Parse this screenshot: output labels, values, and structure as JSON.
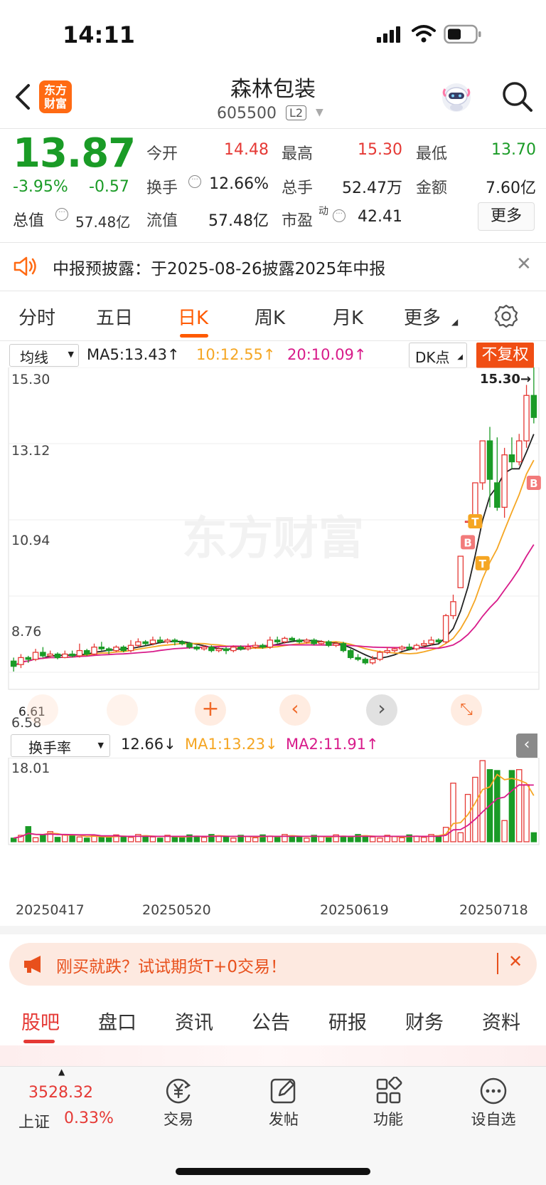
{
  "status": {
    "time": "14:11"
  },
  "header": {
    "logo_line1": "东方",
    "logo_line2": "财富",
    "name": "森林包装",
    "code": "605500",
    "l2": "L2"
  },
  "quote": {
    "price": "13.87",
    "change_pct": "-3.95%",
    "change": "-0.57",
    "total_value_label": "总值",
    "total_value": "57.48亿",
    "open_label": "今开",
    "open": "14.48",
    "high_label": "最高",
    "high": "15.30",
    "low_label": "最低",
    "low": "13.70",
    "turnover_label": "换手",
    "turnover": "12.66%",
    "volume_label": "总手",
    "volume": "52.47万",
    "amount_label": "金额",
    "amount": "7.60亿",
    "float_label": "流值",
    "float_value": "57.48亿",
    "pe_label": "市盈",
    "pe_sup": "动",
    "pe": "42.41",
    "more_label": "更多"
  },
  "notice": {
    "text": "中报预披露：于2025-08-26披露2025年中报"
  },
  "kline_tabs": [
    {
      "label": "分时",
      "active": false
    },
    {
      "label": "五日",
      "active": false
    },
    {
      "label": "日K",
      "active": true
    },
    {
      "label": "周K",
      "active": false
    },
    {
      "label": "月K",
      "active": false
    },
    {
      "label": "更多",
      "active": false
    }
  ],
  "ma_legend": {
    "selector": "均线",
    "ma5": "MA5:13.43↑",
    "ma10": "10:12.55↑",
    "ma20": "20:10.09↑",
    "dk_label": "DK点",
    "fq_label": "不复权",
    "colors": {
      "ma5": "#222222",
      "ma10": "#f5a623",
      "ma20": "#d81b8a"
    }
  },
  "price_axis": {
    "labels": [
      "15.30",
      "13.12",
      "10.94",
      "8.76",
      "6.58"
    ],
    "max_marker": "15.30→",
    "min_marker": "6.61"
  },
  "watermark": "东方财富",
  "turnover_legend": {
    "selector": "换手率",
    "value": "12.66↓",
    "ma1": "MA1:13.23↓",
    "ma2": "MA2:11.91↑",
    "axis_max": "18.01"
  },
  "date_axis": [
    "20250417",
    "20250520",
    "20250619",
    "20250718"
  ],
  "chart_data": {
    "type": "candlestick",
    "ylim": [
      6.58,
      15.3
    ],
    "price_labels": [
      15.3,
      13.12,
      10.94,
      8.76,
      6.58
    ],
    "candles": [
      [
        6.9,
        6.75,
        7.0,
        6.6
      ],
      [
        6.8,
        7.0,
        7.1,
        6.7
      ],
      [
        7.0,
        6.95,
        7.05,
        6.85
      ],
      [
        6.95,
        7.15,
        7.25,
        6.9
      ],
      [
        7.15,
        7.05,
        7.3,
        7.0
      ],
      [
        7.05,
        7.1,
        7.2,
        7.0
      ],
      [
        7.1,
        7.0,
        7.15,
        6.95
      ],
      [
        7.0,
        7.1,
        7.2,
        6.98
      ],
      [
        7.1,
        7.05,
        7.2,
        7.0
      ],
      [
        7.05,
        7.2,
        7.4,
        7.0
      ],
      [
        7.2,
        7.1,
        7.25,
        7.05
      ],
      [
        7.1,
        7.3,
        7.4,
        7.05
      ],
      [
        7.3,
        7.25,
        7.45,
        7.2
      ],
      [
        7.25,
        7.2,
        7.3,
        7.1
      ],
      [
        7.2,
        7.3,
        7.35,
        7.15
      ],
      [
        7.3,
        7.2,
        7.35,
        7.15
      ],
      [
        7.2,
        7.35,
        7.5,
        7.15
      ],
      [
        7.35,
        7.45,
        7.55,
        7.3
      ],
      [
        7.45,
        7.4,
        7.5,
        7.35
      ],
      [
        7.4,
        7.5,
        7.6,
        7.35
      ],
      [
        7.5,
        7.45,
        7.6,
        7.4
      ],
      [
        7.45,
        7.5,
        7.55,
        7.4
      ],
      [
        7.5,
        7.45,
        7.55,
        7.35
      ],
      [
        7.45,
        7.4,
        7.5,
        7.35
      ],
      [
        7.4,
        7.3,
        7.45,
        7.25
      ],
      [
        7.3,
        7.25,
        7.35,
        7.2
      ],
      [
        7.25,
        7.3,
        7.35,
        7.2
      ],
      [
        7.3,
        7.2,
        7.35,
        7.15
      ],
      [
        7.2,
        7.25,
        7.3,
        7.15
      ],
      [
        7.25,
        7.2,
        7.3,
        7.1
      ],
      [
        7.2,
        7.3,
        7.35,
        7.15
      ],
      [
        7.3,
        7.25,
        7.35,
        7.2
      ],
      [
        7.25,
        7.3,
        7.4,
        7.2
      ],
      [
        7.3,
        7.35,
        7.45,
        7.25
      ],
      [
        7.35,
        7.3,
        7.4,
        7.25
      ],
      [
        7.3,
        7.5,
        7.6,
        7.25
      ],
      [
        7.5,
        7.45,
        7.6,
        7.4
      ],
      [
        7.45,
        7.55,
        7.6,
        7.4
      ],
      [
        7.55,
        7.5,
        7.6,
        7.45
      ],
      [
        7.5,
        7.45,
        7.55,
        7.4
      ],
      [
        7.45,
        7.5,
        7.55,
        7.4
      ],
      [
        7.5,
        7.4,
        7.55,
        7.35
      ],
      [
        7.4,
        7.45,
        7.5,
        7.35
      ],
      [
        7.45,
        7.35,
        7.5,
        7.3
      ],
      [
        7.35,
        7.4,
        7.45,
        7.3
      ],
      [
        7.4,
        7.2,
        7.45,
        7.15
      ],
      [
        7.2,
        7.0,
        7.25,
        6.95
      ],
      [
        7.0,
        6.95,
        7.1,
        6.9
      ],
      [
        6.95,
        6.85,
        7.0,
        6.8
      ],
      [
        6.85,
        6.95,
        7.05,
        6.8
      ],
      [
        6.95,
        7.15,
        7.2,
        6.9
      ],
      [
        7.15,
        7.2,
        7.3,
        7.1
      ],
      [
        7.2,
        7.25,
        7.3,
        7.15
      ],
      [
        7.25,
        7.3,
        7.35,
        7.2
      ],
      [
        7.3,
        7.25,
        7.4,
        7.2
      ],
      [
        7.25,
        7.35,
        7.4,
        7.2
      ],
      [
        7.35,
        7.4,
        7.5,
        7.3
      ],
      [
        7.4,
        7.5,
        7.6,
        7.35
      ],
      [
        7.5,
        7.45,
        7.55,
        7.4
      ],
      [
        7.45,
        8.2,
        8.25,
        7.4
      ],
      [
        8.2,
        8.6,
        8.8,
        8.1
      ],
      [
        9.0,
        9.9,
        9.9,
        9.0
      ],
      [
        10.9,
        10.9,
        10.9,
        10.9
      ],
      [
        10.9,
        12.0,
        12.0,
        10.9
      ],
      [
        12.0,
        13.2,
        13.2,
        11.8
      ],
      [
        13.2,
        12.1,
        13.6,
        11.3
      ],
      [
        12.0,
        11.3,
        13.3,
        11.2
      ],
      [
        11.3,
        12.8,
        13.0,
        11.0
      ],
      [
        12.8,
        12.6,
        13.3,
        12.4
      ],
      [
        12.6,
        13.2,
        13.4,
        12.5
      ],
      [
        13.2,
        14.5,
        14.8,
        13.0
      ],
      [
        14.5,
        13.87,
        15.3,
        13.7
      ]
    ],
    "turnover_ylim": [
      0,
      18.01
    ]
  },
  "promo": {
    "text": "刚买就跌？试试期货T+0交易！"
  },
  "bottom_tabs": [
    {
      "label": "股吧",
      "active": true
    },
    {
      "label": "盘口",
      "active": false
    },
    {
      "label": "资讯",
      "active": false
    },
    {
      "label": "公告",
      "active": false
    },
    {
      "label": "研报",
      "active": false
    },
    {
      "label": "财务",
      "active": false
    },
    {
      "label": "资料",
      "active": false
    }
  ],
  "index": {
    "value": "3528.32",
    "name": "上证",
    "pct": "0.33%"
  },
  "nav": [
    {
      "label": "交易",
      "icon": "yuan-icon"
    },
    {
      "label": "发帖",
      "icon": "edit-icon"
    },
    {
      "label": "功能",
      "icon": "grid-icon"
    },
    {
      "label": "设自选",
      "icon": "more-dots-icon"
    }
  ]
}
